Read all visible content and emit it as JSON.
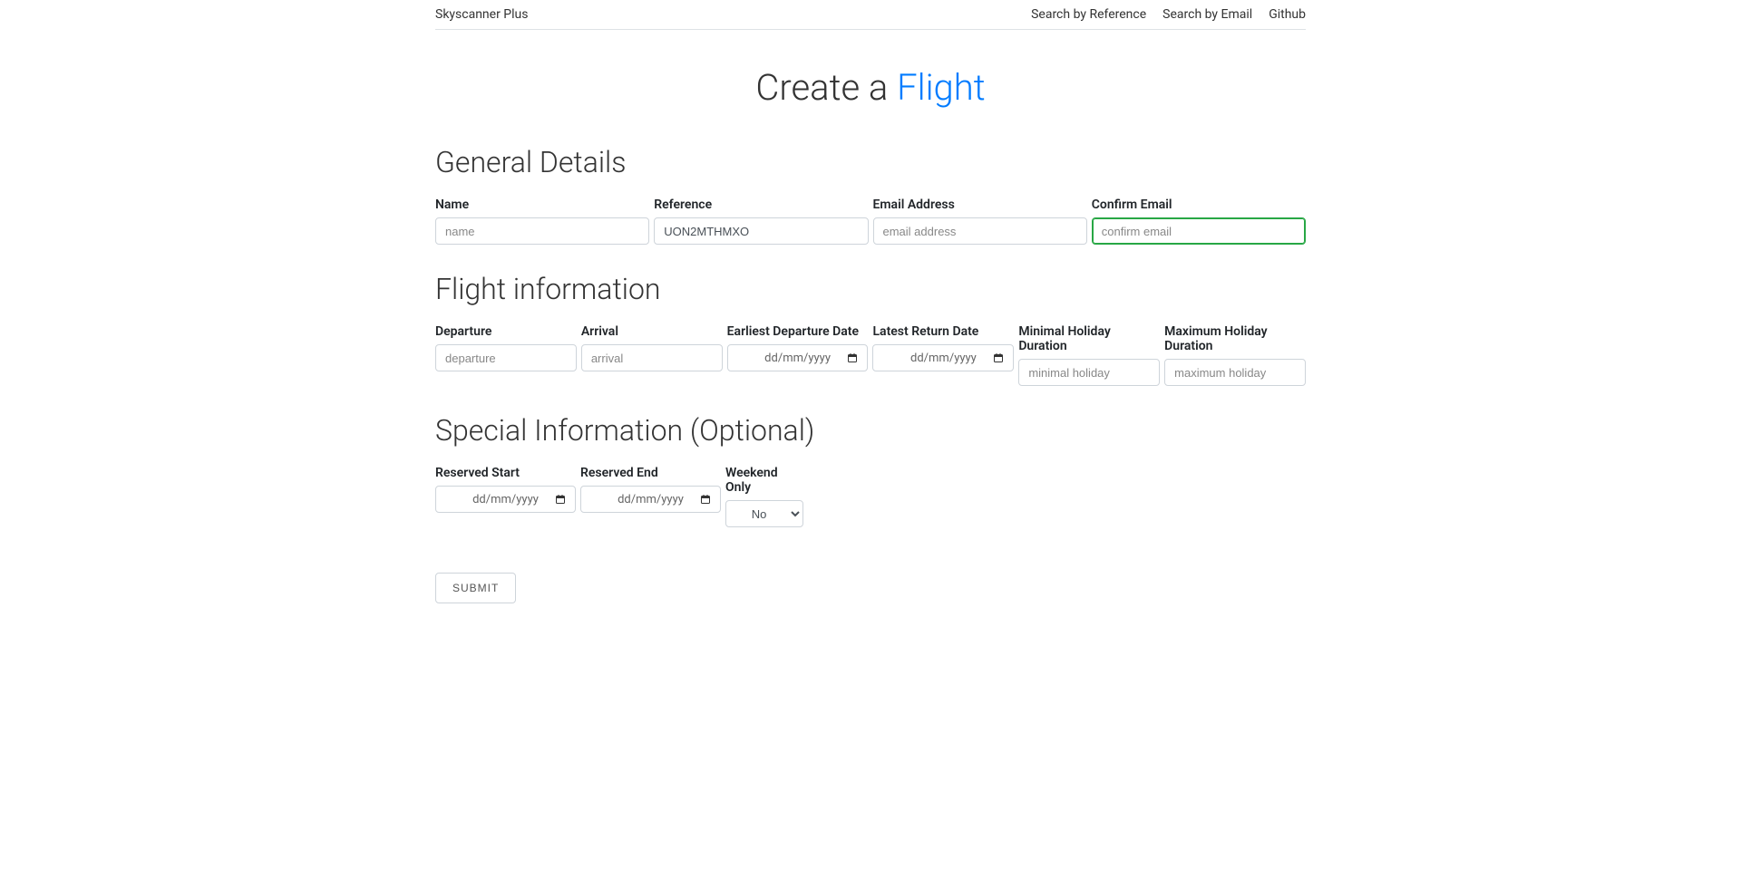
{
  "nav": {
    "brand": "Skyscanner Plus",
    "links": {
      "search_ref": "Search by Reference",
      "search_email": "Search by Email",
      "github": "Github"
    }
  },
  "title": {
    "prefix": "Create a ",
    "accent": "Flight"
  },
  "sections": {
    "general": "General Details",
    "flight": "Flight information",
    "special": "Special Information (Optional)"
  },
  "general": {
    "name": {
      "label": "Name",
      "placeholder": "name",
      "value": ""
    },
    "reference": {
      "label": "Reference",
      "placeholder": "",
      "value": "UON2MTHMXO"
    },
    "email": {
      "label": "Email Address",
      "placeholder": "email address",
      "value": ""
    },
    "confirm_email": {
      "label": "Confirm Email",
      "placeholder": "confirm email",
      "value": ""
    }
  },
  "flight": {
    "departure": {
      "label": "Departure",
      "placeholder": "departure",
      "value": ""
    },
    "arrival": {
      "label": "Arrival",
      "placeholder": "arrival",
      "value": ""
    },
    "earliest_departure": {
      "label": "Earliest Departure Date",
      "placeholder": "dd/mm/yyyy"
    },
    "latest_return": {
      "label": "Latest Return Date",
      "placeholder": "dd/mm/yyyy"
    },
    "min_holiday": {
      "label": "Minimal Holiday Duration",
      "placeholder": "minimal holiday",
      "value": ""
    },
    "max_holiday": {
      "label": "Maximum Holiday Duration",
      "placeholder": "maximum holiday",
      "value": ""
    }
  },
  "special": {
    "reserved_start": {
      "label": "Reserved Start",
      "placeholder": "dd/mm/yyyy"
    },
    "reserved_end": {
      "label": "Reserved End",
      "placeholder": "dd/mm/yyyy"
    },
    "weekend_only": {
      "label": "Weekend Only",
      "selected": "No"
    }
  },
  "submit_label": "Submit"
}
